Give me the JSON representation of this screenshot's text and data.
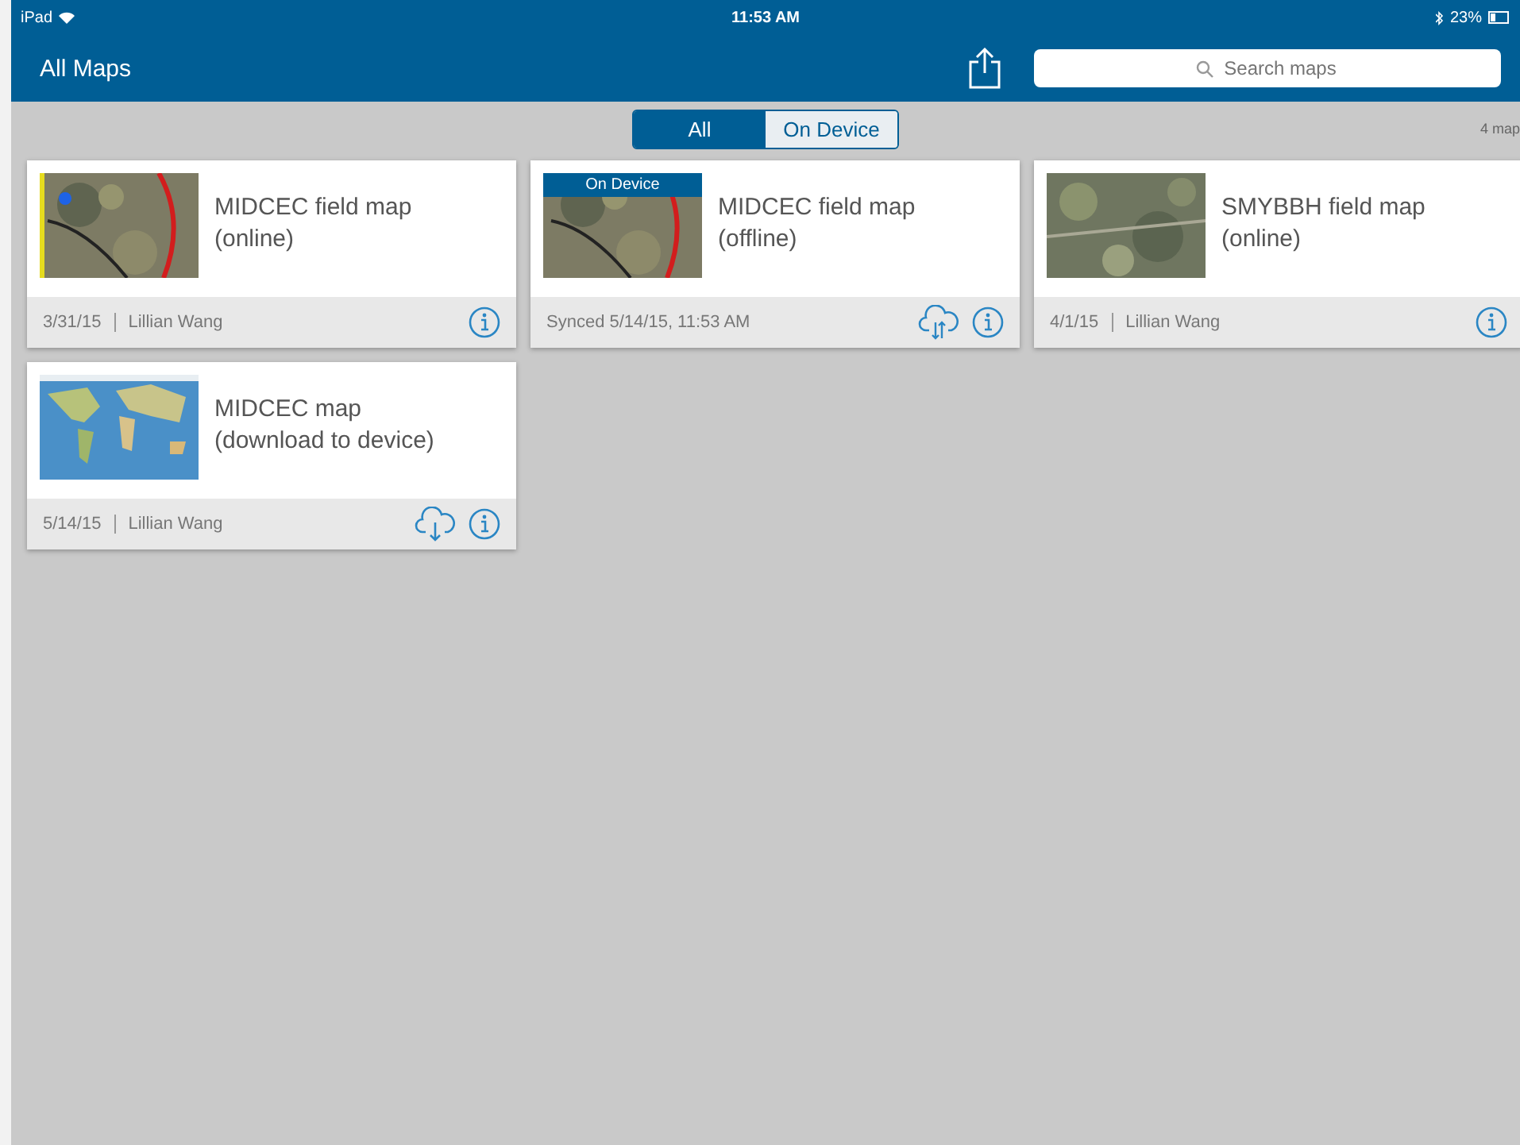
{
  "status_bar": {
    "device": "iPad",
    "time": "11:53 AM",
    "battery": "23%"
  },
  "nav": {
    "title": "All Maps",
    "search": {
      "placeholder": "Search maps"
    }
  },
  "filter": {
    "segments": [
      {
        "label": "All",
        "selected": true
      },
      {
        "label": "On Device",
        "selected": false
      }
    ],
    "count": "4 map"
  },
  "maps": [
    {
      "title": "MIDCEC field map (online)",
      "thumbnail": {
        "kind": "picture"
      },
      "meta": [
        "3/31/15",
        "Lillian Wang"
      ],
      "actions": [
        {
          "kind": "info"
        }
      ]
    },
    {
      "title": "MIDCEC field map (offline)",
      "thumbnail": {
        "kind": "picture"
      },
      "badge": "On Device",
      "meta": [
        "Synced 5/14/15, 11:53 AM"
      ],
      "actions": [
        {
          "kind": "sync"
        },
        {
          "kind": "info"
        }
      ]
    },
    {
      "title": "SMYBBH field map (online)",
      "thumbnail": {
        "kind": "picture"
      },
      "meta": [
        "4/1/15",
        "Lillian Wang"
      ],
      "actions": [
        {
          "kind": "info"
        }
      ]
    },
    {
      "title": "MIDCEC map (download to device)",
      "thumbnail": {
        "kind": "picture"
      },
      "meta": [
        "5/14/15",
        "Lillian Wang"
      ],
      "actions": [
        {
          "kind": "download"
        },
        {
          "kind": "info"
        }
      ]
    }
  ]
}
